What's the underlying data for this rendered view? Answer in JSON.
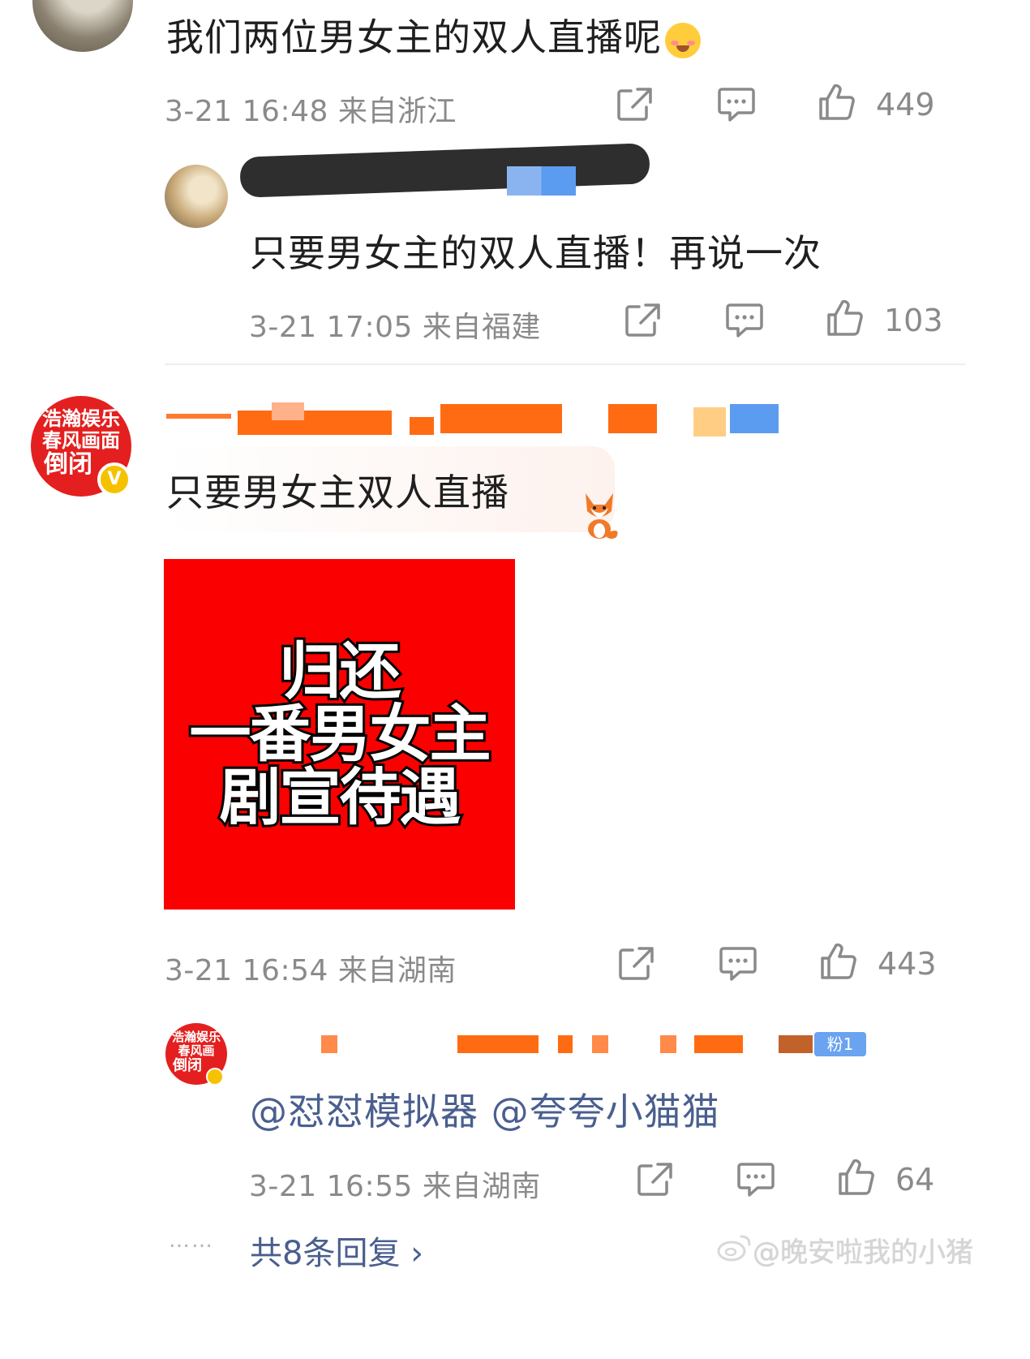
{
  "comments": [
    {
      "text": "我们两位男女主的双人直播呢",
      "emoji": "blushing-face",
      "meta": "3-21 16:48  来自浙江",
      "likes": "449"
    },
    {
      "text": "只要男女主的双人直播！再说一次",
      "meta": "3-21 17:05  来自福建",
      "likes": "103"
    },
    {
      "badge_lines": [
        "浩瀚娱乐",
        "春风画面",
        "倒闭"
      ],
      "verified_mark": "V",
      "text": "只要男女主双人直播",
      "poster_lines": [
        "归还",
        "一番男女主",
        "剧宣待遇"
      ],
      "meta": "3-21 16:54  来自湖南",
      "likes": "443"
    },
    {
      "badge_lines": [
        "浩瀚娱乐",
        "春风画",
        "倒闭"
      ],
      "fan_tag": "粉1",
      "mention_1": "@怼怼模拟器",
      "mention_2": "@夸夸小猫猫",
      "meta": "3-21 16:55  来自湖南",
      "likes": "64"
    }
  ],
  "footer": {
    "more_replies": "共8条回复 ›",
    "dots": "……",
    "watermark": "@晚安啦我的小猪"
  },
  "colors": {
    "brand_red": "#e3201f",
    "poster_red": "#fa0000",
    "mention_blue": "#4a5f8f",
    "meta_gray": "#8a8a8a"
  }
}
